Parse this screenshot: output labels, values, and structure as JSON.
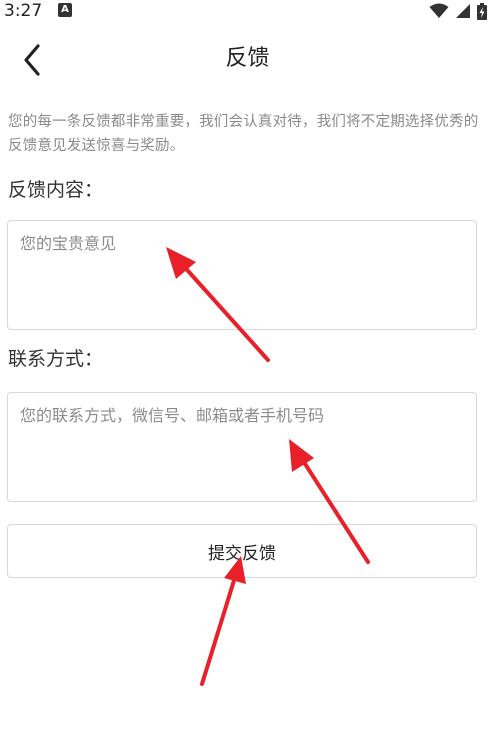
{
  "status_bar": {
    "time": "3:27",
    "notification_glyph": "A",
    "icons": [
      "wifi-icon",
      "signal-icon",
      "battery-charging-icon"
    ]
  },
  "nav": {
    "back_icon": "chevron-left-icon",
    "title": "反馈"
  },
  "intro": "您的每一条反馈都非常重要，我们会认真对待，我们将不定期选择优秀的反馈意见发送惊喜与奖励。",
  "feedback": {
    "label": "反馈内容：",
    "value": "",
    "placeholder": "您的宝贵意见"
  },
  "contact": {
    "label": "联系方式：",
    "value": "",
    "placeholder": "您的联系方式，微信号、邮箱或者手机号码"
  },
  "submit": {
    "label": "提交反馈"
  },
  "annotation": {
    "arrow_color": "#e8202a",
    "arrow_icon": "red-arrow-annotation"
  }
}
